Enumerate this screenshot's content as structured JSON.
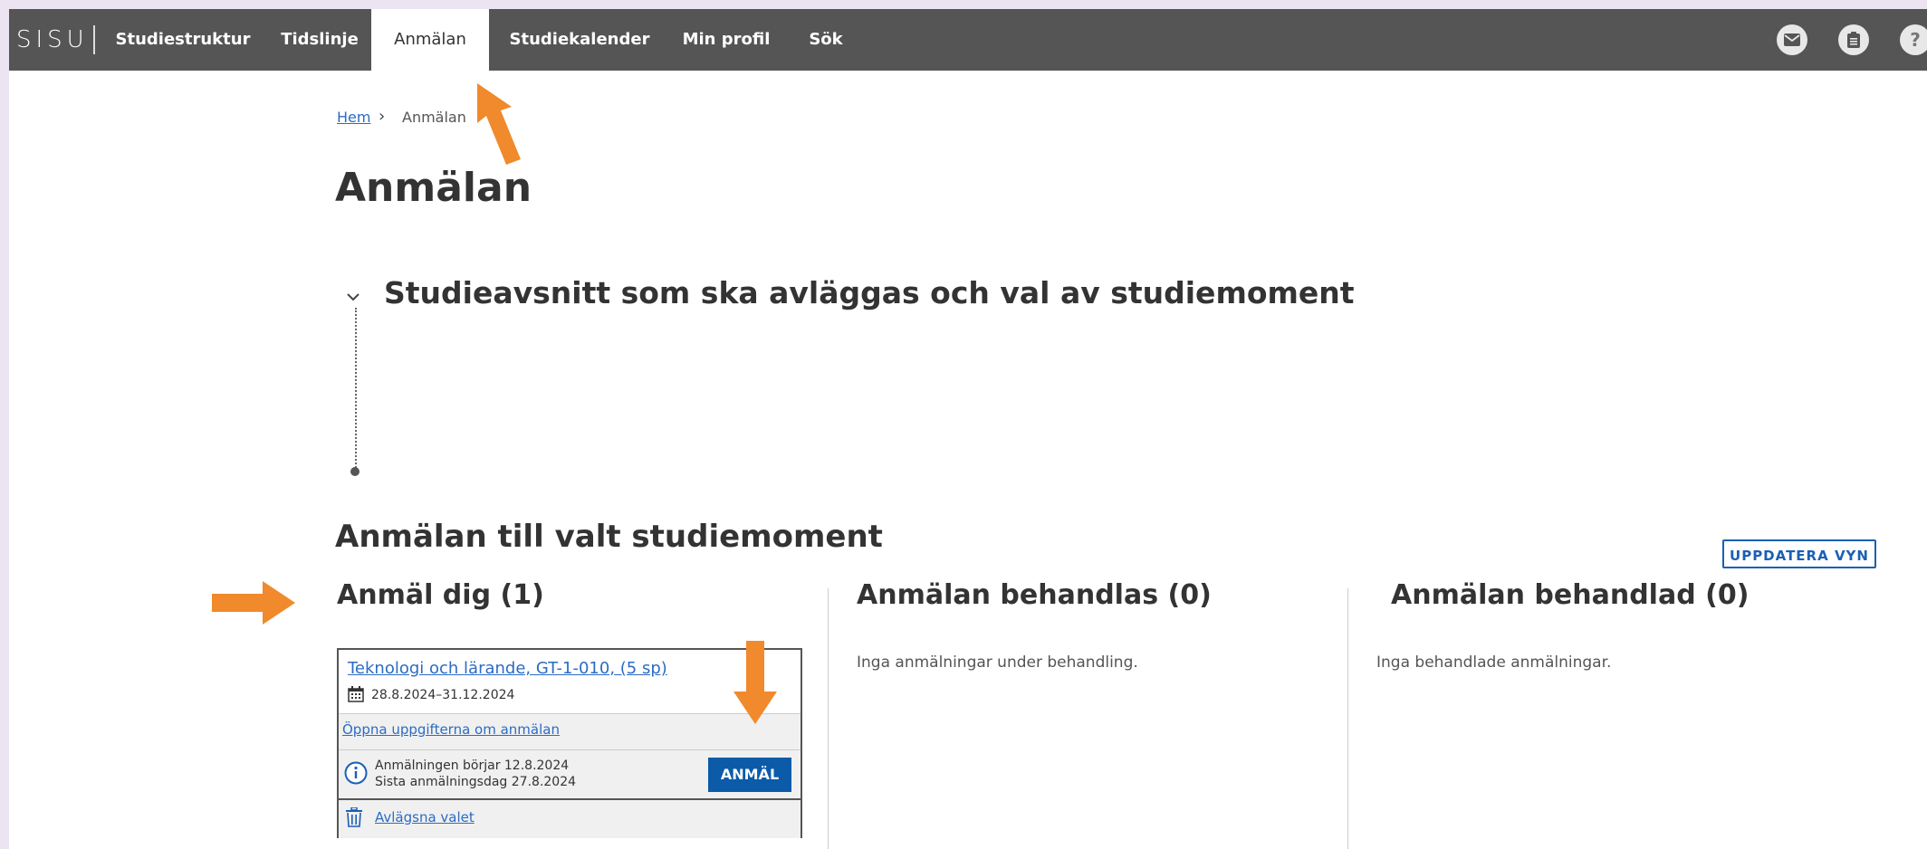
{
  "nav": {
    "logo": "SISU",
    "items": [
      "Studiestruktur",
      "Tidslinje",
      "Anmälan",
      "Studiekalender",
      "Min profil",
      "Sök"
    ],
    "active": "Anmälan"
  },
  "breadcrumb": {
    "home": "Hem",
    "current": "Anmälan"
  },
  "page_title": "Anmälan",
  "section": {
    "title": "Studieavsnitt som ska avläggas och val av studiemoment"
  },
  "registration": {
    "title": "Anmälan till valt studiemoment",
    "refresh_label": "UPPDATERA VYN",
    "columns": [
      {
        "title": "Anmäl dig (1)"
      },
      {
        "title": "Anmälan behandlas (0)",
        "empty": "Inga anmälningar under behandling."
      },
      {
        "title": "Anmälan behandlad (0)",
        "empty": "Inga behandlade anmälningar."
      }
    ]
  },
  "card": {
    "course_link": "Teknologi och lärande, GT-1-010, (5 sp)",
    "dates": "28.8.2024–31.12.2024",
    "open_details": "Öppna uppgifterna om anmälan",
    "info_line1": "Anmälningen börjar 12.8.2024",
    "info_line2": "Sista anmälningsdag 27.8.2024",
    "register_button": "ANMÄL",
    "remove_link": "Avlägsna valet"
  },
  "colors": {
    "nav_bg": "#555555",
    "accent_blue": "#0b5ba8",
    "link_blue": "#2b6cc4",
    "arrow_orange": "#f08a2c"
  }
}
